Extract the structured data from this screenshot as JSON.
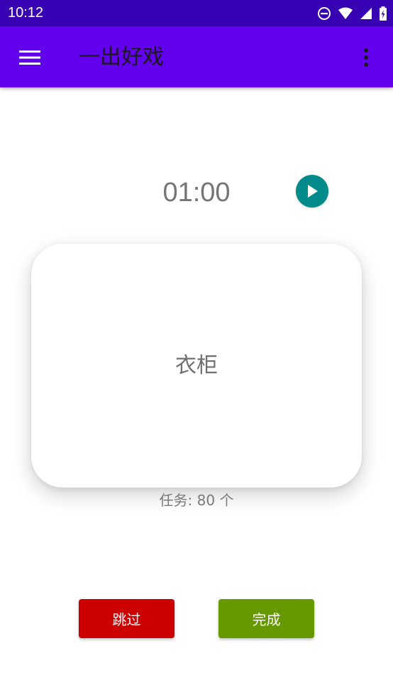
{
  "status_bar": {
    "time": "10:12",
    "icons": [
      "do-not-disturb-icon",
      "wifi-icon",
      "signal-icon",
      "battery-icon"
    ],
    "background": "#3700b3"
  },
  "app_bar": {
    "title": "一出好戏",
    "background": "#6200ee",
    "icons": [
      "menu-icon",
      "more-vert-icon"
    ]
  },
  "timer": {
    "time": "01:00",
    "play_icon": "play-icon",
    "play_color": "#008a8a"
  },
  "card": {
    "word": "衣柜"
  },
  "task_count": "任务: 80 个",
  "buttons": {
    "skip_label": "跳过",
    "skip_color": "#cc0000",
    "done_label": "完成",
    "done_color": "#669900"
  }
}
